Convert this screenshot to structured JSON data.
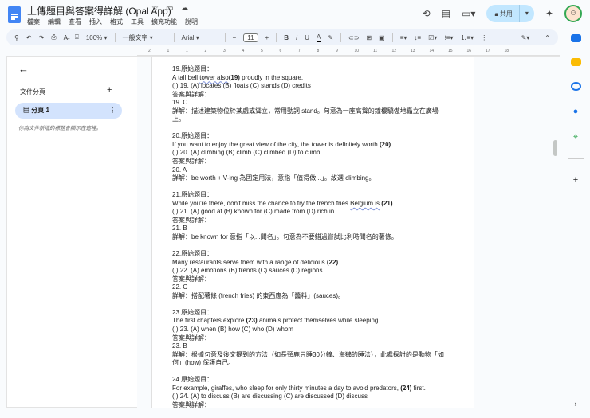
{
  "app": {
    "title": "上傳題目與答案得詳解 (Opal App)",
    "menu": [
      "檔案",
      "編輯",
      "查看",
      "插入",
      "格式",
      "工具",
      "擴充功能",
      "說明"
    ],
    "share_label": "共用"
  },
  "toolbar": {
    "zoom": "100%",
    "style": "一般文字",
    "font": "Arial",
    "font_size": "11"
  },
  "ruler": [
    "2",
    "1",
    "1",
    "2",
    "3",
    "4",
    "5",
    "6",
    "7",
    "8",
    "9",
    "10",
    "11",
    "12",
    "13",
    "14",
    "15",
    "16",
    "17",
    "18"
  ],
  "sidebar": {
    "section": "文件分頁",
    "tab": "分頁 1",
    "hint": "你為文件新增的標題會顯示在這裡。"
  },
  "questions": [
    {
      "title": "19.原始題目：",
      "pre": "A tall bell ",
      "ul": "tower also",
      "bold": "(19)",
      "post": " proudly in the square.",
      "options": "( ) 19. (A) locates (B) floats (C) stands (D) credits",
      "label": "答案與詳解：",
      "answer": "19. C",
      "explain": "詳解：描述建築物位於某處或聳立，常用動詞 stand。句意為一座高聳的鐘樓驕傲地矗立在廣場上。"
    },
    {
      "title": "20.原始題目：",
      "pre": "If you want to enjoy the great view of the city, the tower is definitely worth ",
      "ul": "",
      "bold": "(20)",
      "post": ".",
      "options": "( ) 20. (A) climbing (B) climb (C) climbed (D) to climb",
      "label": "答案與詳解：",
      "answer": "20. A",
      "explain": "詳解：be worth + V-ing 為固定用法，意指「值得做...」。故選 climbing。"
    },
    {
      "title": "21.原始題目：",
      "pre": "While you're there, don't miss the chance to try the french fries ",
      "ul": "Belgium is",
      "bold": " (21)",
      "post": ".",
      "options": "( ) 21. (A) good at (B) known for (C) made from (D) rich in",
      "label": "答案與詳解：",
      "answer": "21. B",
      "explain": "詳解：be known for 意指「以...聞名」。句意為不要錯過嘗試比利時聞名的薯條。"
    },
    {
      "title": "22.原始題目：",
      "pre": "Many restaurants serve them with a range of delicious ",
      "ul": "",
      "bold": "(22)",
      "post": ".",
      "options": "( ) 22. (A) emotions (B) trends (C) sauces (D) regions",
      "label": "答案與詳解：",
      "answer": "22. C",
      "explain": "詳解：搭配薯條 (french fries) 的東西應為「醬料」(sauces)。"
    },
    {
      "title": "23.原始題目：",
      "pre": "The first chapters explore ",
      "ul": "",
      "bold": "(23)",
      "post": " animals protect themselves while sleeping.",
      "options": "( ) 23. (A) when (B) how (C) who (D) whom",
      "label": "答案與詳解：",
      "answer": "23. B",
      "explain": "詳解：根據句意及後文提到的方法（如長頸鹿只睡30分鐘、海獺的睡法），此處探討的是動物「如何」(how) 保護自己。"
    },
    {
      "title": "24.原始題目：",
      "pre": "For example, giraffes, who sleep for only thirty minutes a day to avoid predators, ",
      "ul": "",
      "bold": "(24)",
      "post": " first.",
      "options": "( ) 24. (A) to discuss (B) are discussing (C) are discussed (D) discuss",
      "label": "答案與詳解：",
      "answer": "",
      "explain": ""
    }
  ]
}
